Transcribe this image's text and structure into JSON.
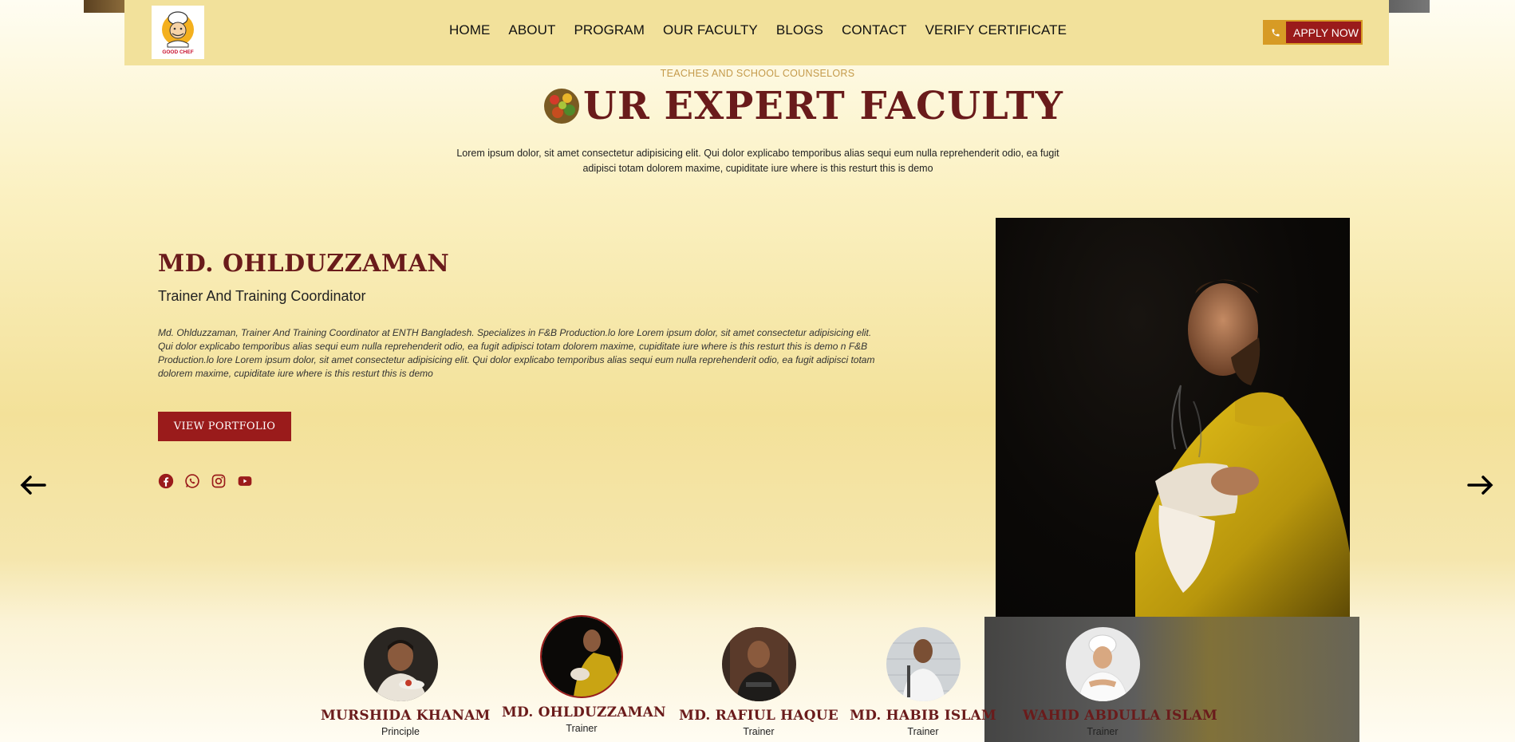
{
  "header": {
    "logo_text": "GOOD CHEF",
    "nav": [
      "HOME",
      "ABOUT",
      "PROGRAM",
      "OUR FACULTY",
      "BLOGS",
      "CONTACT",
      "VERIFY CERTIFICATE"
    ],
    "apply_label": "APPLY NOW"
  },
  "section": {
    "eyebrow": "TEACHES AND SCHOOL COUNSELORS",
    "title": "UR EXPERT FACULTY",
    "lead": "Lorem ipsum dolor, sit amet consectetur adipisicing elit. Qui dolor explicabo temporibus alias sequi eum nulla reprehenderit odio, ea fugit adipisci totam dolorem maxime, cupiditate iure where is this resturt this is demo"
  },
  "featured": {
    "name": "MD. OHLDUZZAMAN",
    "role": "Trainer And Training Coordinator",
    "bio": "Md. Ohlduzzaman, Trainer And Training Coordinator at ENTH Bangladesh. Specializes in F&B Production.lo lore Lorem ipsum dolor, sit amet consectetur adipisicing elit. Qui dolor explicabo temporibus alias sequi eum nulla reprehenderit odio, ea fugit adipisci totam dolorem maxime, cupiditate iure where is this resturt this is demo n F&B Production.lo lore Lorem ipsum dolor, sit amet consectetur adipisicing elit. Qui dolor explicabo temporibus alias sequi eum nulla reprehenderit odio, ea fugit adipisci totam dolorem maxime, cupiditate iure where is this resturt this is demo",
    "portfolio_label": "VIEW PORTFOLIO",
    "socials": [
      "facebook-icon",
      "whatsapp-icon",
      "instagram-icon",
      "youtube-icon"
    ]
  },
  "faculty": [
    {
      "name": "MURSHIDA KHANAM",
      "role": "Principle"
    },
    {
      "name": "MD. OHLDUZZAMAN",
      "role": "Trainer"
    },
    {
      "name": "MD. RAFIUL HAQUE",
      "role": "Trainer"
    },
    {
      "name": "MD. HABIB ISLAM",
      "role": "Trainer"
    },
    {
      "name": "WAHID ABDULLA ISLAM",
      "role": "Trainer"
    }
  ],
  "colors": {
    "brand": "#6a1b1b",
    "accent": "#d79b25",
    "button": "#9a1b1b",
    "header_bg": "#f2e19b"
  }
}
